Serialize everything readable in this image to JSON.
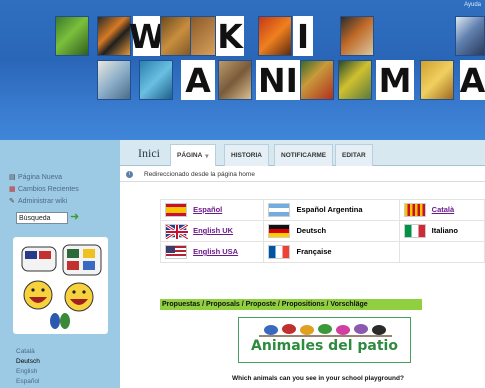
{
  "banner": {
    "help_label": "Ayuda",
    "logo_letters_row1": [
      "W",
      "i",
      "K",
      "I"
    ],
    "logo_letters_row2": [
      "A",
      "NI",
      "M",
      "A"
    ],
    "colors": {
      "background": "#2a66b8"
    }
  },
  "tabbar": {
    "site_label": "Inici",
    "tabs": [
      {
        "label": "PÁGINA",
        "has_dropdown": true,
        "active": true
      },
      {
        "label": "HISTORIA"
      },
      {
        "label": "NOTIFICARME"
      },
      {
        "label": "EDITAR"
      }
    ]
  },
  "sidebar": {
    "links": [
      {
        "label": "Página Nueva",
        "icon": "new-page-icon"
      },
      {
        "label": "Cambios Recientes",
        "icon": "calendar-icon"
      },
      {
        "label": "Administrar wiki",
        "icon": "admin-icon"
      }
    ],
    "search": {
      "value": "Búsqueda"
    },
    "languages": [
      {
        "label": "Català",
        "current": false
      },
      {
        "label": "Deutsch",
        "current": true
      },
      {
        "label": "English",
        "current": false
      },
      {
        "label": "Español",
        "current": false
      }
    ]
  },
  "content": {
    "redirect_text": "Redireccionado desde la página home",
    "languages_grid": [
      [
        {
          "label": "Español",
          "flag": "es",
          "link": true
        },
        {
          "label": "Español Argentina",
          "flag": "ar",
          "link": false
        },
        {
          "label": "Català",
          "flag": "cat",
          "link": true
        }
      ],
      [
        {
          "label": "English UK",
          "flag": "uk",
          "link": true
        },
        {
          "label": "Deutsch",
          "flag": "de",
          "link": false
        },
        {
          "label": "Italiano",
          "flag": "it",
          "link": false
        }
      ],
      [
        {
          "label": "English USA",
          "flag": "us",
          "link": true
        },
        {
          "label": "Française",
          "flag": "fr",
          "link": false
        },
        {
          "label": "",
          "flag": "",
          "link": false
        }
      ]
    ],
    "proposals": "Propuestas / Proposals / Proposte / Propositions / Vorschläge",
    "patio_title": "Animales del patio",
    "question": "Which animals can you see in your school playground?"
  }
}
